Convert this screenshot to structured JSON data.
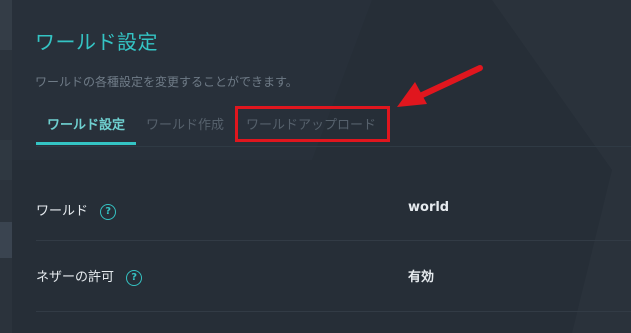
{
  "page": {
    "title": "ワールド設定",
    "subtitle": "ワールドの各種設定を変更することができます。"
  },
  "tabs": [
    {
      "label": "ワールド設定",
      "active": true
    },
    {
      "label": "ワールド作成",
      "active": false
    },
    {
      "label": "ワールドアップロード",
      "active": false
    }
  ],
  "settings": [
    {
      "label": "ワールド",
      "value": "world"
    },
    {
      "label": "ネザーの許可",
      "value": "有効"
    }
  ],
  "help_glyph": "?",
  "colors": {
    "accent": "#34c4c4",
    "background": "#262e37",
    "annotation": "#e0161e"
  },
  "icons": [
    "question-circle-icon",
    "annotation-arrow"
  ]
}
